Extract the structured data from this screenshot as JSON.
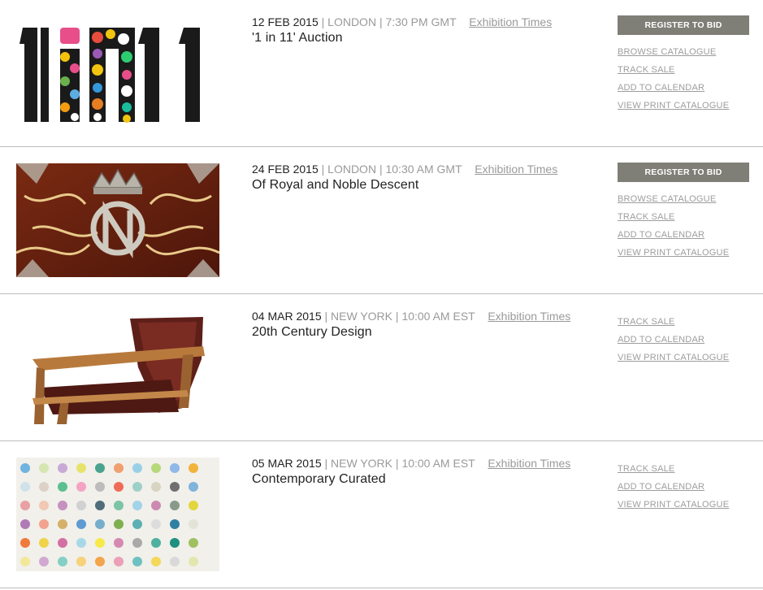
{
  "sales": [
    {
      "date": "12 FEB 2015",
      "location": "LONDON",
      "time": "7:30 PM GMT",
      "exhibition": "Exhibition Times",
      "title": "'1 in 11' Auction",
      "register": "REGISTER TO BID",
      "links": [
        "BROWSE CATALOGUE",
        "TRACK SALE",
        "ADD TO CALENDAR",
        "VIEW PRINT CATALOGUE"
      ]
    },
    {
      "date": "24 FEB 2015",
      "location": "LONDON",
      "time": "10:30 AM GMT",
      "exhibition": "Exhibition Times",
      "title": "Of Royal and Noble Descent",
      "register": "REGISTER TO BID",
      "links": [
        "BROWSE CATALOGUE",
        "TRACK SALE",
        "ADD TO CALENDAR",
        "VIEW PRINT CATALOGUE"
      ]
    },
    {
      "date": "04 MAR 2015",
      "location": "NEW YORK",
      "time": "10:00 AM EST",
      "exhibition": "Exhibition Times",
      "title": "20th Century Design",
      "links": [
        "TRACK SALE",
        "ADD TO CALENDAR",
        "VIEW PRINT CATALOGUE"
      ]
    },
    {
      "date": "05 MAR 2015",
      "location": "NEW YORK",
      "time": "10:00 AM EST",
      "exhibition": "Exhibition Times",
      "title": "Contemporary Curated",
      "links": [
        "TRACK SALE",
        "ADD TO CALENDAR",
        "VIEW PRINT CATALOGUE"
      ]
    }
  ],
  "colors": {
    "button": "#7f7f77",
    "muted": "#9a9a9a",
    "divider": "#bdbdbd"
  }
}
